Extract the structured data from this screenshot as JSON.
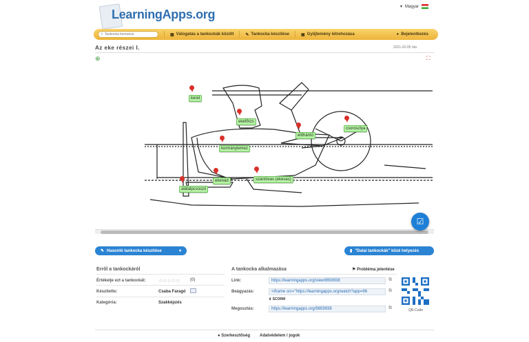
{
  "header": {
    "logo_text": "LearningApps.org",
    "language": "Magyar"
  },
  "nav": {
    "search_placeholder": "Tankocka keresése",
    "items": [
      {
        "label": "Válogatás a tankockák között"
      },
      {
        "label": "Tankocka készítése"
      },
      {
        "label": "Gyűjtemény létrehozása"
      }
    ],
    "login": "Bejelentkezés"
  },
  "page": {
    "title": "Az eke részei I.",
    "date": "2021-02-05 óta"
  },
  "labels": [
    {
      "text": "kereł"
    },
    {
      "text": "ekefőrzs"
    },
    {
      "text": "előhántó"
    },
    {
      "text": "csoroszlya"
    },
    {
      "text": "kormánylemez"
    },
    {
      "text": "szántóvas (ekevas)"
    },
    {
      "text": "ekenád"
    },
    {
      "text": "alátalpcsúszó"
    }
  ],
  "buttons": {
    "similar": "Hasonló tankocka készítése",
    "favorite": "\"Dalai tankockák\" közé helyezés"
  },
  "about": {
    "title": "Erről a tankockáról",
    "rate_label": "Értékelje ezt a tankockát:",
    "rating_count": "(0)",
    "author_label": "Készítette:",
    "author": "Csaba Faragó",
    "category_label": "Kategória:",
    "category": "Szakképzés"
  },
  "usage": {
    "title": "A tankocka alkalmazása",
    "report": "Probléma jelentése",
    "link_label": "Link:",
    "link": "https://learningapps.org/view9659938",
    "embed_label": "Beágyazás:",
    "embed": "<iframe src=\"https://learningapps.org/watch?app=96",
    "scorm": "SCORM",
    "share_label": "Megosztás:",
    "share": "https://learningapps.org/9659938",
    "qr_label": "QR-Code"
  },
  "footer": {
    "imprint": "Szerkesztőség",
    "privacy": "Adatvédelem / jogok"
  },
  "colors": {
    "accent": "#2b83d3",
    "nav": "#f1bd45",
    "label_bg": "#b8f0a8",
    "pin": "#d9302a"
  }
}
